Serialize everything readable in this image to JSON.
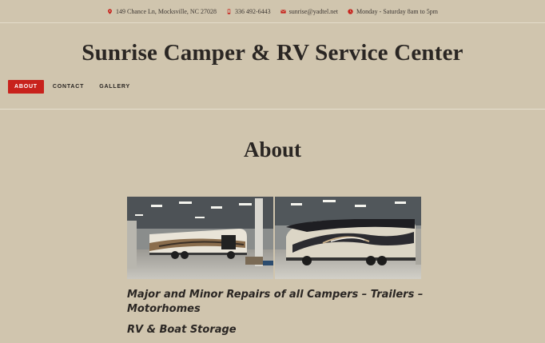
{
  "topbar": {
    "address": "149 Chance Ln, Mocksville, NC 27028",
    "phone": "336 492-6443",
    "email": "sunrise@yadtel.net",
    "hours": "Monday - Saturday 8am to 5pm"
  },
  "site": {
    "title": "Sunrise Camper & RV Service Center"
  },
  "nav": {
    "items": [
      {
        "label": "ABOUT",
        "active": true
      },
      {
        "label": "CONTACT",
        "active": false
      },
      {
        "label": "GALLERY",
        "active": false
      }
    ]
  },
  "page": {
    "title": "About",
    "paragraphs": [
      "Major and Minor Repairs of all Campers – Trailers – Motorhomes",
      "RV & Boat Storage"
    ]
  },
  "colors": {
    "background": "#d0c5ae",
    "accent": "#c8221c",
    "text": "#2a2623"
  },
  "icons": {
    "address": "map-pin-icon",
    "phone": "phone-icon",
    "email": "envelope-icon",
    "hours": "clock-icon"
  }
}
